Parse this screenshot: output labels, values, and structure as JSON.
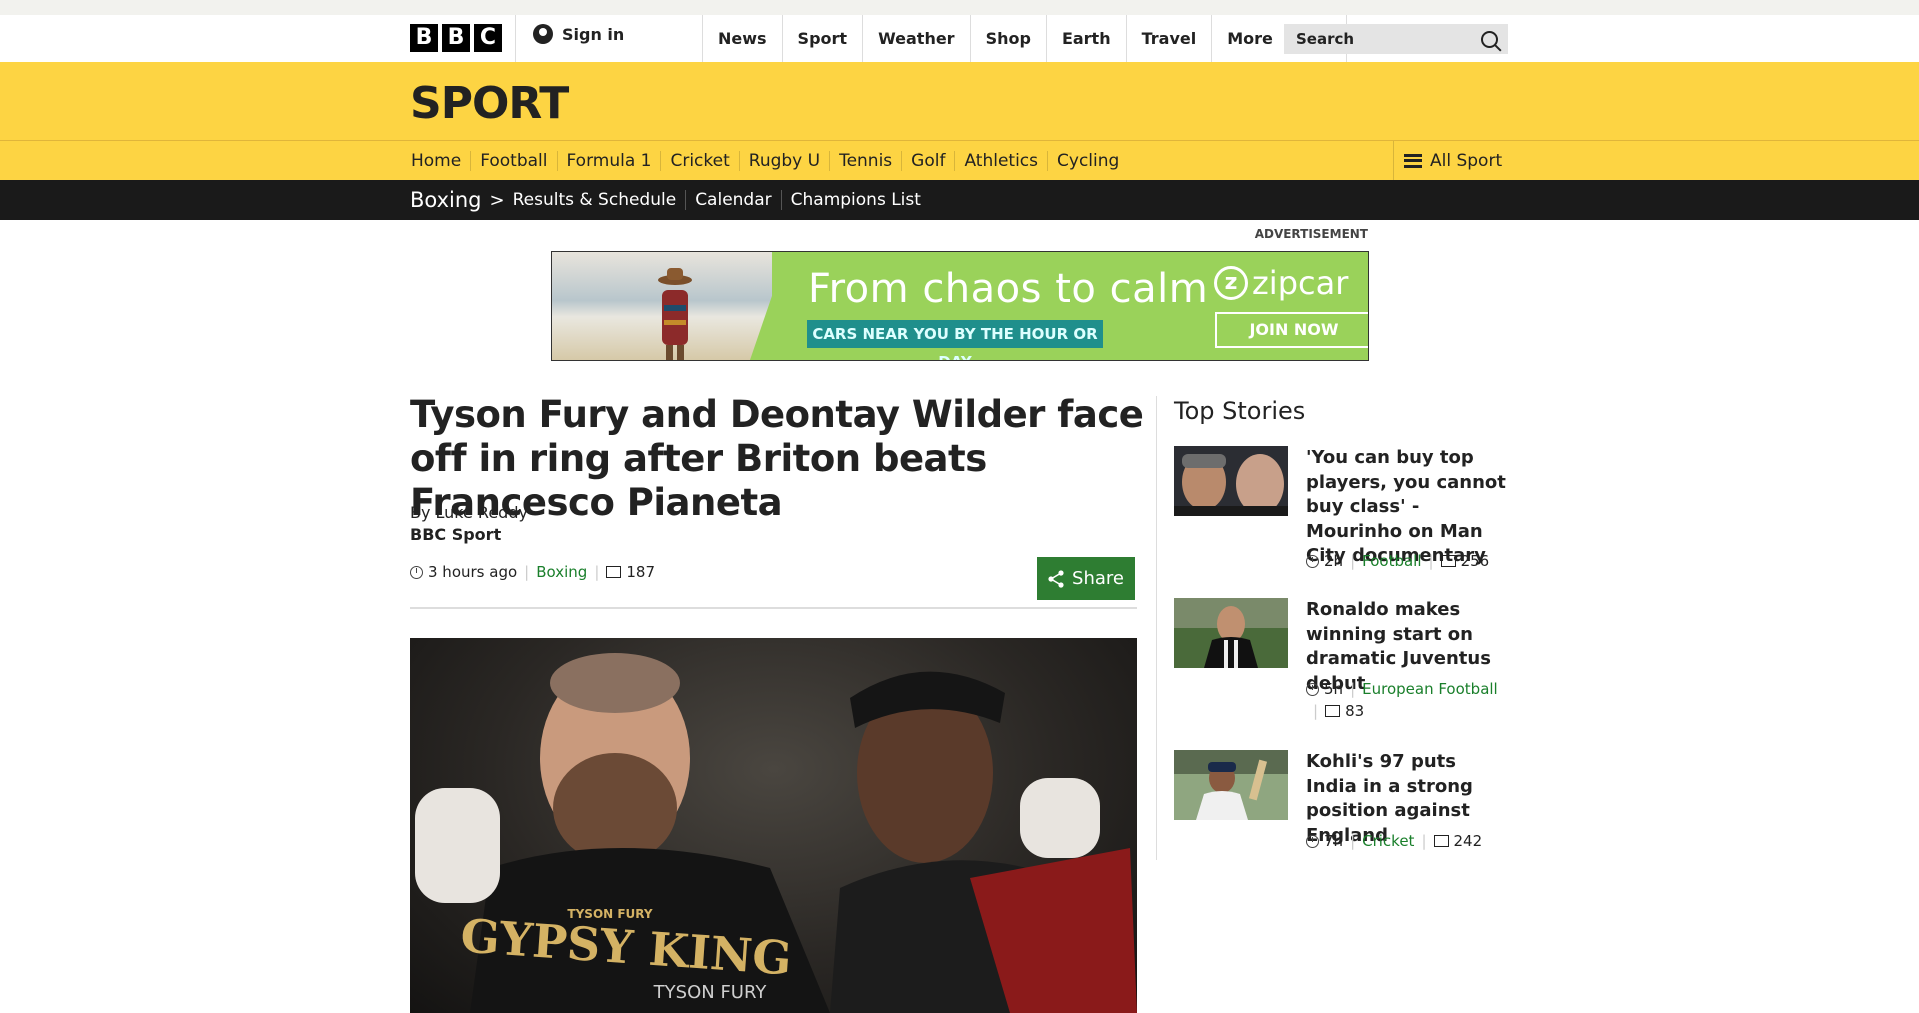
{
  "masthead": {
    "logo_letters": [
      "B",
      "B",
      "C"
    ],
    "signin_label": "Sign in",
    "nav": [
      "News",
      "Sport",
      "Weather",
      "Shop",
      "Earth",
      "Travel"
    ],
    "more_label": "More",
    "search_placeholder": "Search"
  },
  "sport": {
    "title": "SPORT",
    "nav": [
      "Home",
      "Football",
      "Formula 1",
      "Cricket",
      "Rugby U",
      "Tennis",
      "Golf",
      "Athletics",
      "Cycling"
    ],
    "all_sport_label": "All Sport"
  },
  "section": {
    "name": "Boxing",
    "chevron": ">",
    "links": [
      "Results & Schedule",
      "Calendar",
      "Champions List"
    ]
  },
  "ad": {
    "label": "ADVERTISEMENT",
    "headline": "From chaos to calm",
    "subline": "CARS NEAR YOU BY THE HOUR OR DAY",
    "brand": "zipcar",
    "brand_letter": "z",
    "cta": "JOIN NOW"
  },
  "article": {
    "headline": "Tyson Fury and Deontay Wilder face off in ring after Briton beats Francesco Pianeta",
    "byline": "By Luke Reddy",
    "source": "BBC Sport",
    "time": "3 hours ago",
    "tag": "Boxing",
    "comments": "187",
    "share_label": "Share",
    "image_text": {
      "shirt_small": "TYSON FURY",
      "shirt_big": "GYPSY KING",
      "shirt_bottom": "TYSON FURY"
    }
  },
  "top_stories": {
    "title": "Top Stories",
    "items": [
      {
        "title": "'You can buy top players, you cannot buy class' - Mourinho on Man City documentary",
        "time": "2h",
        "tag": "Football",
        "comments": "256"
      },
      {
        "title": "Ronaldo makes winning start on dramatic Juventus debut",
        "time": "5h",
        "tag": "European Football",
        "comments": "83"
      },
      {
        "title": "Kohli's 97 puts India in a strong position against England",
        "time": "7h",
        "tag": "Cricket",
        "comments": "242"
      }
    ]
  },
  "colors": {
    "sport_yellow": "#fdd443",
    "subnav_black": "#1a1a1a",
    "share_green": "#2e7d32",
    "tag_green": "#1a7f2b",
    "ad_green": "#9ad25a"
  }
}
